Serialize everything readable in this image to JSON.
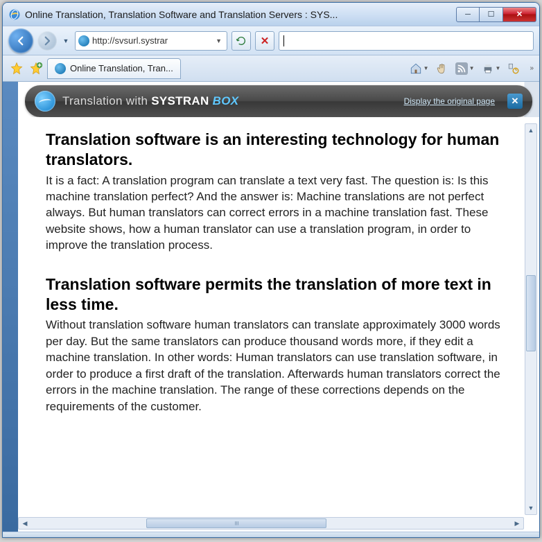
{
  "window": {
    "title": "Online Translation, Translation Software and Translation Servers : SYS..."
  },
  "navbar": {
    "url": "http://svsurl.systrar"
  },
  "tab": {
    "label": "Online Translation, Tran..."
  },
  "systranBar": {
    "prefix": "Translation with ",
    "brand": "SYSTRAN",
    "box": "BOX",
    "link": "Display the original page"
  },
  "article": {
    "sections": [
      {
        "heading": "Translation software is an interesting technology for human translators.",
        "body": "It is a fact: A translation program can translate a text very fast. The question is: Is this machine translation perfect? And the answer is: Machine translations are not perfect always. But human translators can correct errors in a machine translation fast. These website shows, how a human translator can use a translation program, in order to improve the translation process."
      },
      {
        "heading": "Translation software permits the translation of more text in less time.",
        "body": "Without translation software human translators can translate approximately 3000 words per day. But the same translators can produce thousand words more, if they edit a machine translation. In other words: Human translators can use translation software, in order to produce a first draft of the translation. Afterwards human translators correct the errors in the machine translation. The range of these corrections depends on the requirements of the customer."
      }
    ]
  }
}
